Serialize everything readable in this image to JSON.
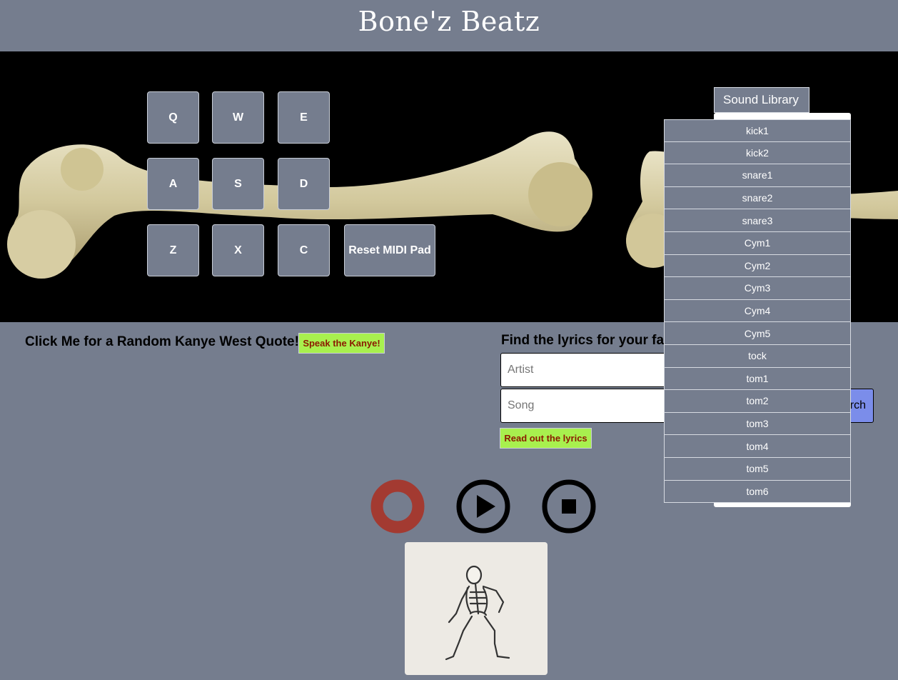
{
  "header": {
    "title": "Bone'z Beatz"
  },
  "midi_pad": {
    "keys": [
      "Q",
      "W",
      "E",
      "A",
      "S",
      "D",
      "Z",
      "X",
      "C"
    ],
    "reset_label": "Reset MIDI Pad"
  },
  "sound_library": {
    "button_label": "Sound Library",
    "items": [
      "kick1",
      "kick2",
      "snare1",
      "snare2",
      "snare3",
      "Cym1",
      "Cym2",
      "Cym3",
      "Cym4",
      "Cym5",
      "tock",
      "tom1",
      "tom2",
      "tom3",
      "tom4",
      "tom5",
      "tom6"
    ]
  },
  "kanye": {
    "label": "Click Me for a Random Kanye West Quote!",
    "speak_button": "Speak the Kanye!"
  },
  "lyrics": {
    "label": "Find the lyrics for your fav",
    "artist_placeholder": "Artist",
    "song_placeholder": "Song",
    "search_button": "rch",
    "read_button": "Read out the lyrics"
  },
  "controls": {
    "record_icon": "record-icon",
    "play_icon": "play-icon",
    "stop_icon": "stop-icon",
    "record_color": "#a33a31"
  },
  "colors": {
    "background": "#757d8e",
    "stage": "#000000",
    "accent_button": "#a8f04e",
    "search_button": "#7b8dea"
  }
}
